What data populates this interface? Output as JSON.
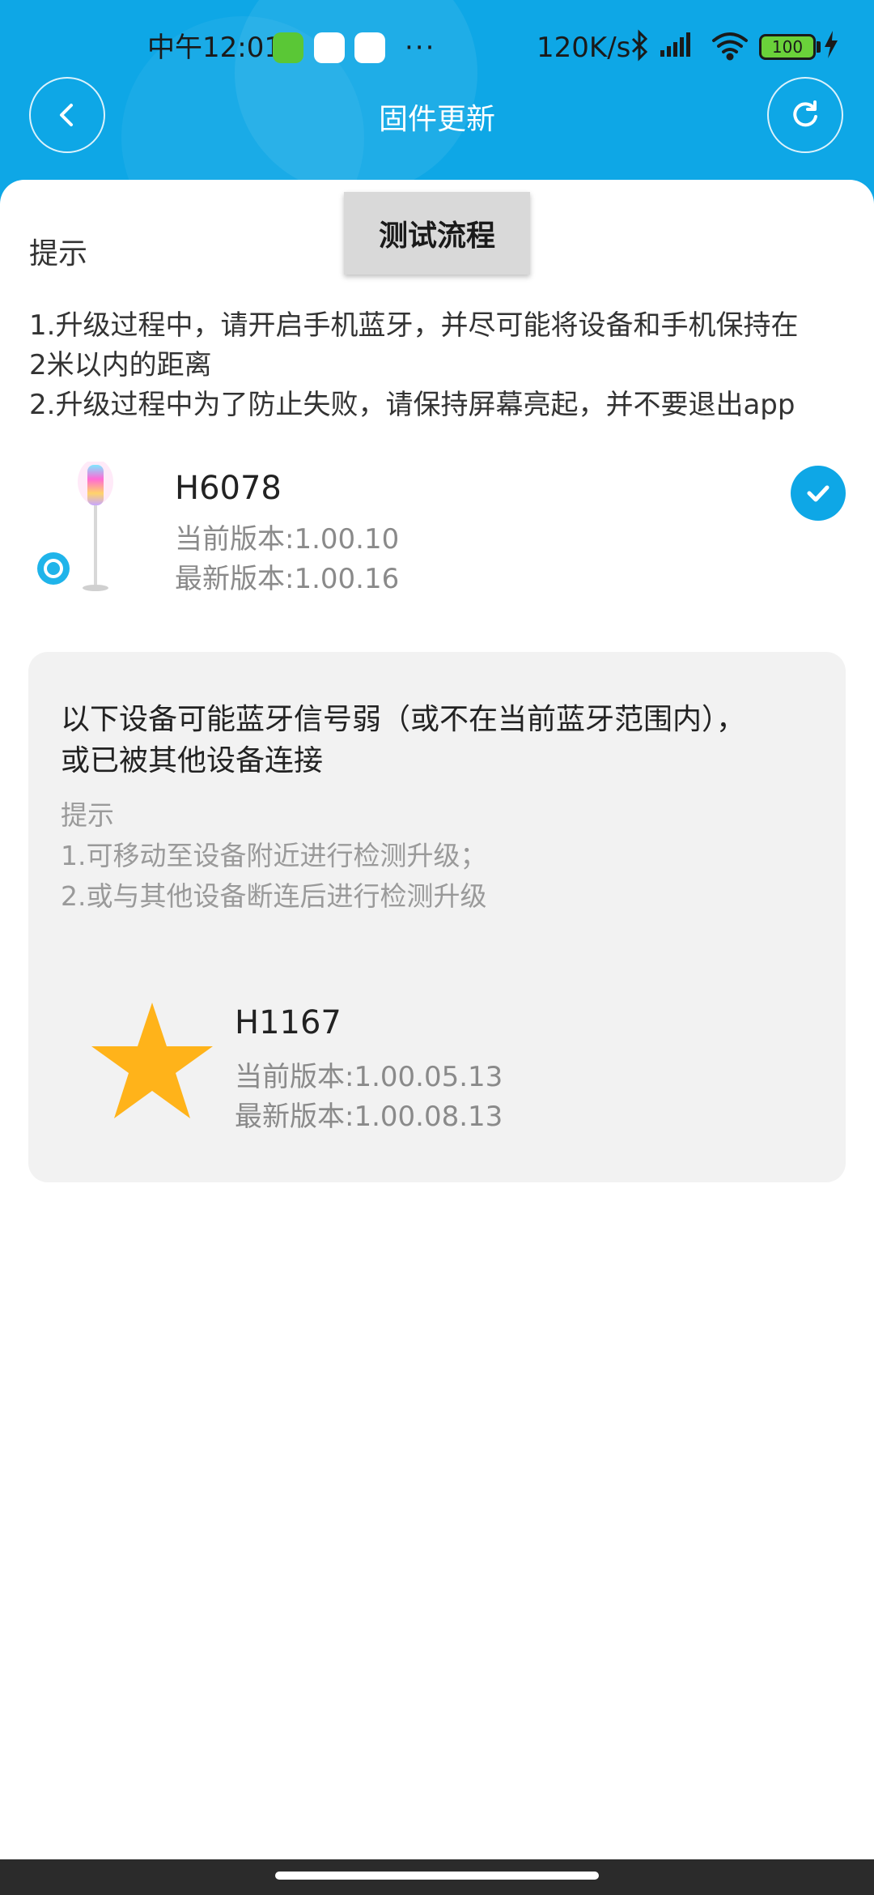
{
  "status_bar": {
    "time": "中午12:01",
    "more": "···",
    "network_speed": "120K/s",
    "battery": "100",
    "icons": [
      "bluetooth-icon",
      "signal-icon",
      "wifi-icon",
      "battery-icon",
      "charging-icon"
    ]
  },
  "header": {
    "title": "固件更新",
    "back_icon": "chevron-left-icon",
    "refresh_icon": "refresh-icon"
  },
  "test_button": {
    "label": "测试流程"
  },
  "tips": {
    "label": "提示",
    "line1": "1.升级过程中，请开启手机蓝牙，并尽可能将设备和手机保持在",
    "line2": "2米以内的距离",
    "line3": "2.升级过程中为了防止失败，请保持屏幕亮起，并不要退出app"
  },
  "device": {
    "name": "H6078",
    "current_version": "当前版本:1.00.10",
    "latest_version": "最新版本:1.00.16",
    "selected": true
  },
  "weak_signal": {
    "title_line1": "以下设备可能蓝牙信号弱（或不在当前蓝牙范围内），",
    "title_line2": "或已被其他设备连接",
    "tip_label": "提示",
    "tip1": "1.可移动至设备附近进行检测升级；",
    "tip2": "2.或与其他设备断连后进行检测升级",
    "device": {
      "name": "H1167",
      "current_version": "当前版本:1.00.05.13",
      "latest_version": "最新版本:1.00.08.13"
    }
  },
  "colors": {
    "primary": "#0ea7e6",
    "card_bg": "#f2f2f2",
    "star": "#ffb31a",
    "muted_text": "#8a8a8a"
  }
}
